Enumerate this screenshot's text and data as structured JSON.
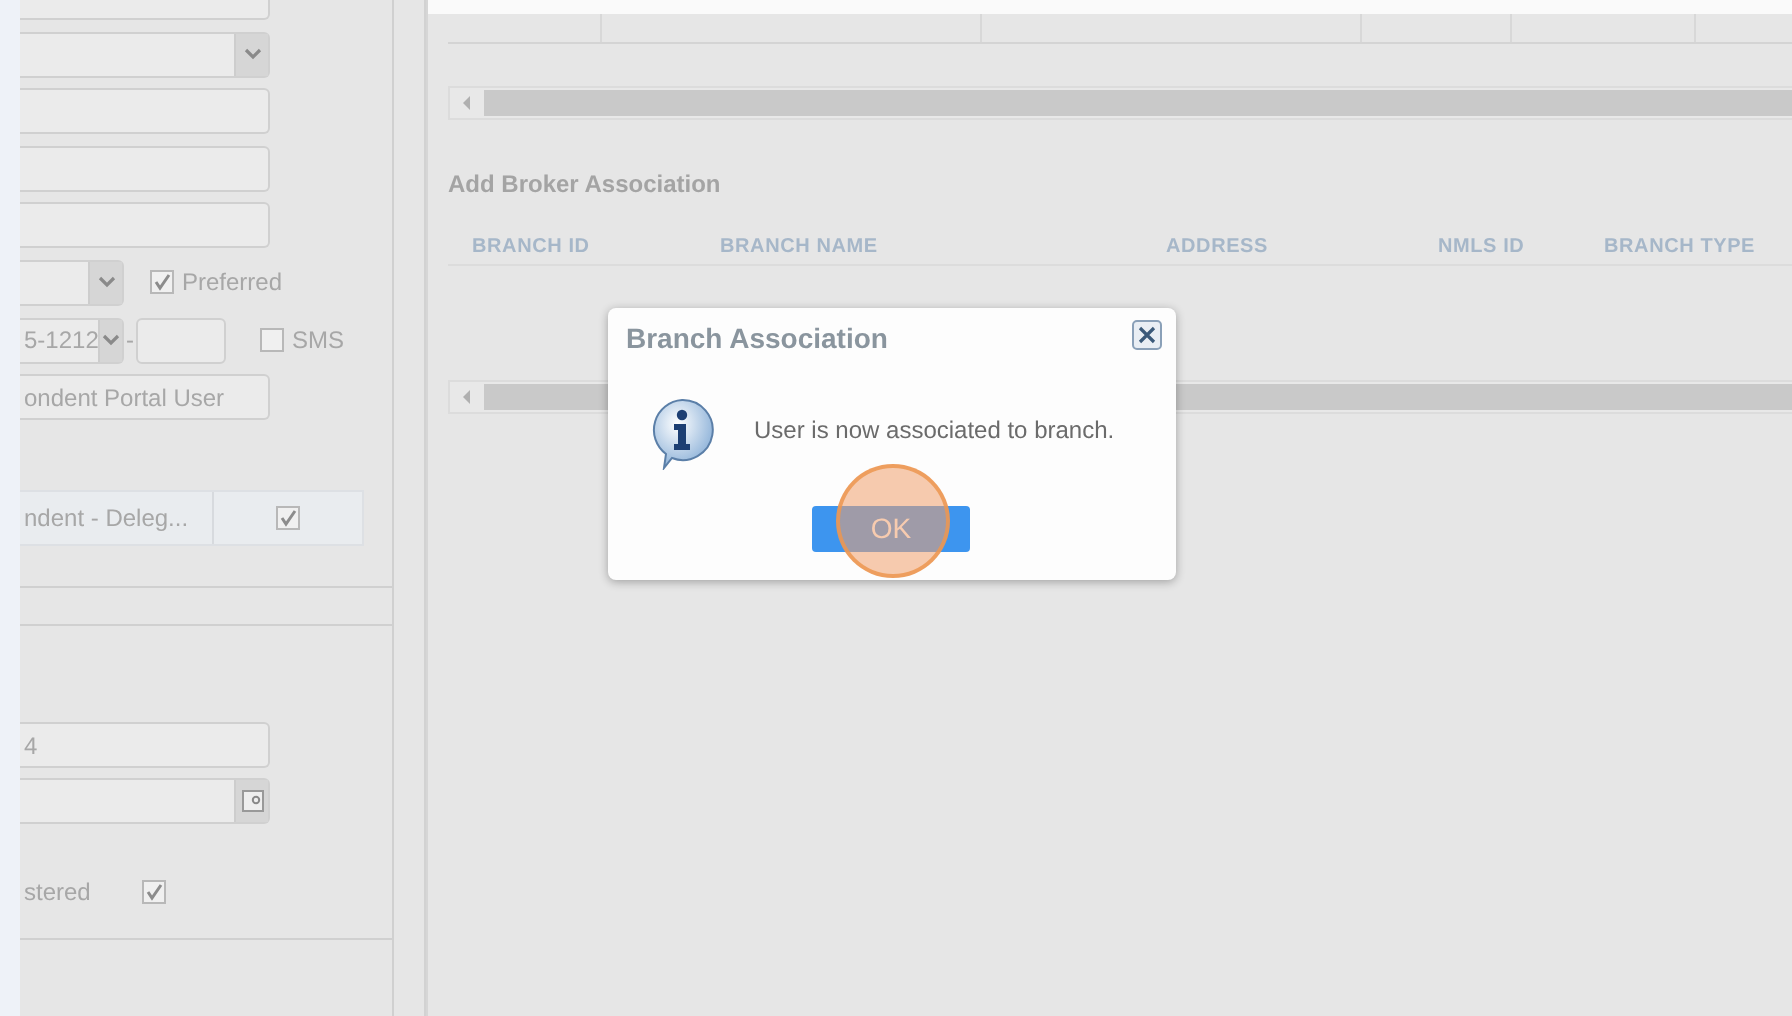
{
  "left_panel": {
    "rows": [
      {
        "kind": "text"
      },
      {
        "kind": "select"
      },
      {
        "kind": "text"
      },
      {
        "kind": "text"
      },
      {
        "kind": "text"
      },
      {
        "kind": "select_check",
        "check_label": "Preferred",
        "checked": true
      },
      {
        "kind": "phone",
        "value": "5-1212",
        "separator": "-",
        "check_label": "SMS",
        "checked": false
      },
      {
        "kind": "text",
        "value": "ondent Portal User"
      }
    ],
    "role_row": {
      "role": "ndent - Deleg...",
      "checked": true
    }
  },
  "left_panel_2": {
    "rows": [
      {
        "kind": "text",
        "value": "4"
      },
      {
        "kind": "date"
      },
      {
        "kind": "check",
        "label": "stered",
        "checked": true
      }
    ]
  },
  "broker_grid": {
    "title": "Add Broker Association",
    "columns": [
      "BRANCH ID",
      "BRANCH NAME",
      "ADDRESS",
      "NMLS ID",
      "BRANCH TYPE"
    ]
  },
  "dialog": {
    "title": "Branch Association",
    "message": "User is now associated to branch.",
    "button": "OK",
    "click_indicator": true
  }
}
